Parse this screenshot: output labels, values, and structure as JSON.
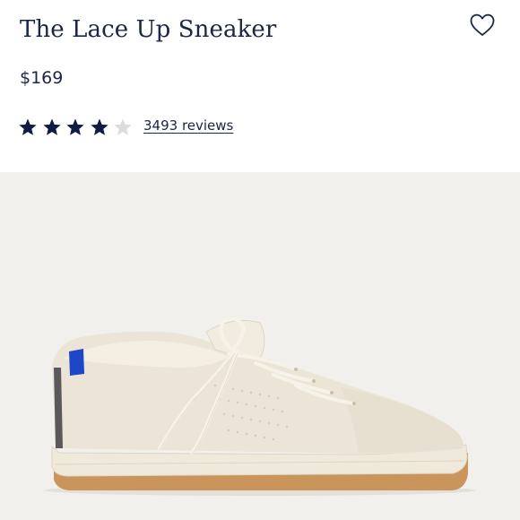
{
  "product": {
    "title": "The Lace Up Sneaker",
    "price": "$169",
    "rating": 4,
    "rating_max": 5,
    "reviews_label": "3493 reviews"
  },
  "icons": {
    "favorite": "heart-outline-icon",
    "star_filled": "star-filled-icon",
    "star_empty": "star-empty-icon"
  },
  "colors": {
    "text": "#1b2547",
    "star_filled": "#0f1b44",
    "star_empty": "#dcdcdc",
    "image_background": "#f2f0ed",
    "accent_tab": "#1e47c8"
  }
}
